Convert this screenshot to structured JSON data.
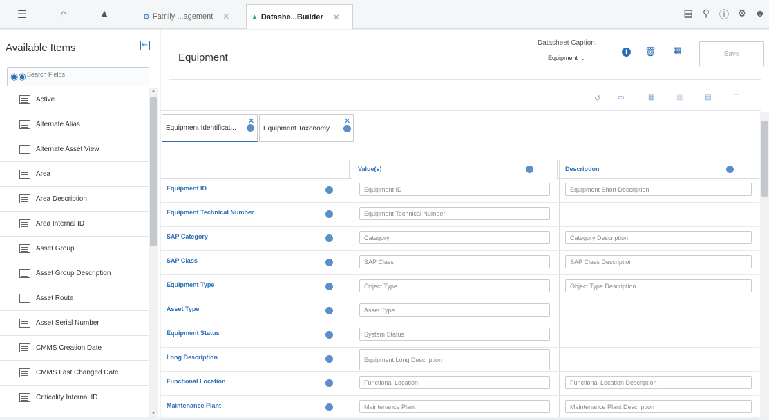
{
  "topbar": {
    "tabs": [
      {
        "label": "Family ...agement"
      },
      {
        "label": "Datashe...Builder"
      }
    ],
    "icons_left": [
      "menu-icon",
      "home-icon",
      "dashboard-icon"
    ],
    "icons_right": [
      "clipboard-icon",
      "search-icon",
      "help-icon",
      "settings-icon",
      "user-icon"
    ]
  },
  "sidebar": {
    "title": "Available Items",
    "search_placeholder": "Search Fields",
    "items": [
      {
        "label": "Active"
      },
      {
        "label": "Alternate Alias"
      },
      {
        "label": "Alternate Asset View"
      },
      {
        "label": "Area"
      },
      {
        "label": "Area Description"
      },
      {
        "label": "Area Internal ID"
      },
      {
        "label": "Asset Group"
      },
      {
        "label": "Asset Group Description"
      },
      {
        "label": "Asset Route"
      },
      {
        "label": "Asset Serial Number"
      },
      {
        "label": "CMMS Creation Date"
      },
      {
        "label": "CMMS Last Changed Date"
      },
      {
        "label": "Criticality Internal ID"
      }
    ]
  },
  "main": {
    "title": "Equipment",
    "caption_label": "Datasheet Caption:",
    "caption_value": "Equipment",
    "save_label": "Save",
    "field_tabs": [
      {
        "label": "Equipment Identificat..."
      },
      {
        "label": "Equipment Taxonomy"
      }
    ],
    "columns": {
      "values": "Value(s)",
      "description": "Description"
    },
    "rows": [
      {
        "name": "Equipment ID",
        "value": "Equipment ID",
        "description": "Equipment Short Description"
      },
      {
        "name": "Equipment Technical Number",
        "value": "Equipment Technical Number",
        "description": ""
      },
      {
        "name": "SAP Category",
        "value": "Category",
        "description": "Category Description"
      },
      {
        "name": "SAP Class",
        "value": "SAP Class",
        "description": "SAP Class Description"
      },
      {
        "name": "Equipment Type",
        "value": "Object Type",
        "description": "Object Type Description"
      },
      {
        "name": "Asset Type",
        "value": "Asset Type",
        "description": ""
      },
      {
        "name": "Equipment Status",
        "value": "System Status",
        "description": ""
      },
      {
        "name": "Long Description",
        "value": "Equipment Long Description",
        "description": ""
      },
      {
        "name": "Functional Location",
        "value": "Functional Location",
        "description": "Functional Location Description"
      },
      {
        "name": "Maintenance Plant",
        "value": "Maintenance Plant",
        "description": "Maintenance Plant Description"
      }
    ]
  },
  "colors": {
    "accent": "#2d6fb7",
    "topbar_bg": "#f5f6f7"
  }
}
